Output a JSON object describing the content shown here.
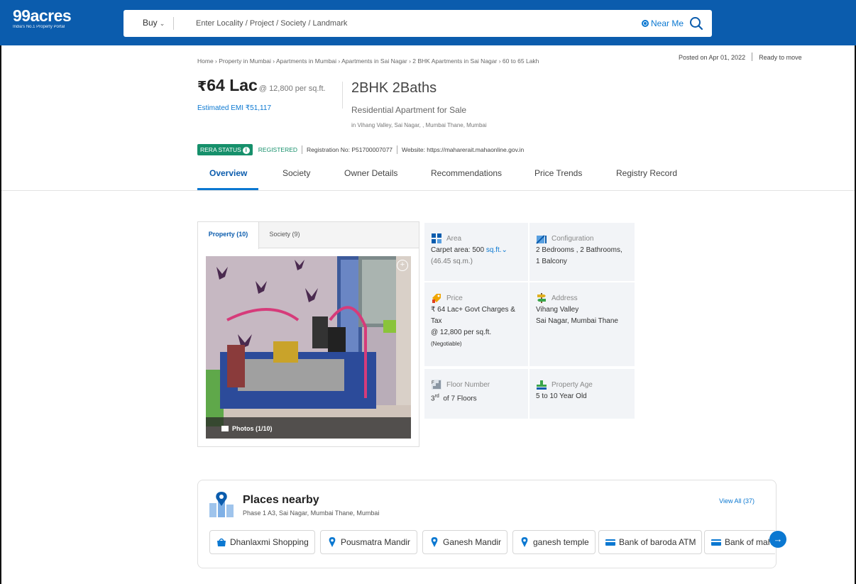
{
  "header": {
    "logo": "99acres",
    "logo_tagline": "India's No.1 Property Portal",
    "buy_label": "Buy",
    "search_placeholder": "Enter Locality / Project / Society / Landmark",
    "near_me_label": "Near Me"
  },
  "breadcrumb": "Home › Property in Mumbai › Apartments in Mumbai › Apartments in Sai Nagar › 2 BHK Apartments in Sai Nagar › 60 to 65 Lakh",
  "meta": {
    "posted": "Posted on Apr 01, 2022",
    "status": "Ready to move"
  },
  "listing": {
    "currency": "₹",
    "price": "64 Lac",
    "price_per_sqft": "@ 12,800 per sq.ft.",
    "emi": "Estimated EMI ₹51,117",
    "config": "2BHK 2Baths",
    "type": "Residential Apartment for Sale",
    "location": "in Vihang Valley, Sai Nagar, , Mumbai Thane, Mumbai"
  },
  "rera": {
    "badge": "RERA STATUS",
    "status": "REGISTERED",
    "registration": "Registration No: P51700007077",
    "website": "Website: https://maharerait.mahaonline.gov.in"
  },
  "tabs": [
    "Overview",
    "Society",
    "Owner Details",
    "Recommendations",
    "Price Trends",
    "Registry Record"
  ],
  "gallery": {
    "tab_property": "Property (10)",
    "tab_society": "Society (9)",
    "photos_label": "Photos (1/10)"
  },
  "details": {
    "area": {
      "label": "Area",
      "value": "Carpet area: 500",
      "unit": "sq.ft.",
      "sub": "(46.45 sq.m.)"
    },
    "configuration": {
      "label": "Configuration",
      "value": "2 Bedrooms , 2 Bathrooms,",
      "value2": "1 Balcony"
    },
    "price": {
      "label": "Price",
      "value": "₹ 64 Lac+ Govt Charges &",
      "value2": "Tax",
      "value3": "@ 12,800 per sq.ft.",
      "note": "(Negotiable)"
    },
    "address": {
      "label": "Address",
      "value": "Vihang Valley",
      "value2": "Sai Nagar, Mumbai Thane"
    },
    "floor": {
      "label": "Floor Number",
      "value_num": "3",
      "value_sup": "rd",
      "value_rest": "of 7 Floors"
    },
    "age": {
      "label": "Property Age",
      "value": "5 to 10 Year Old"
    }
  },
  "places": {
    "title": "Places nearby",
    "subtitle": "Phase 1 A3, Sai Nagar, Mumbai Thane, Mumbai",
    "view_all": "View All (37)",
    "chips": [
      {
        "label": "Dhanlaxmi Shopping",
        "icon": "shopping-bag-icon"
      },
      {
        "label": "Pousmatra Mandir",
        "icon": "location-pin-icon"
      },
      {
        "label": "Ganesh Mandir",
        "icon": "location-pin-icon"
      },
      {
        "label": "ganesh temple",
        "icon": "location-pin-icon"
      },
      {
        "label": "Bank of baroda ATM",
        "icon": "card-icon"
      },
      {
        "label": "Bank of maharashtra",
        "icon": "card-icon"
      }
    ]
  },
  "colors": {
    "brand": "#0b5cad",
    "accent": "#0b78d1",
    "rera": "#16906b"
  }
}
